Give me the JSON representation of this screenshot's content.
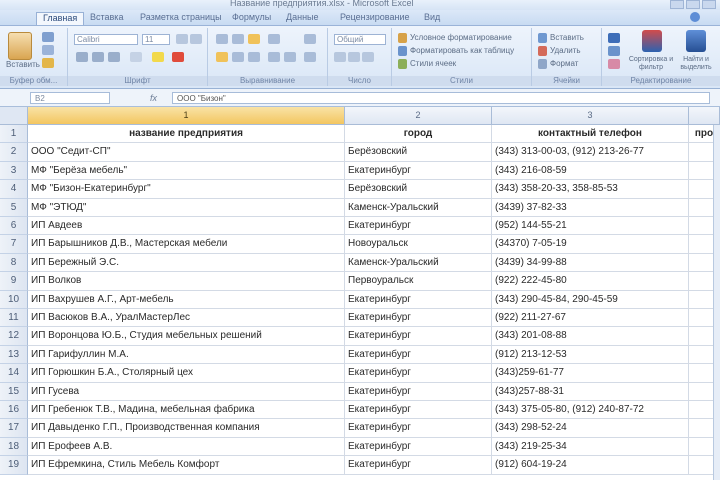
{
  "window": {
    "title": "Название предприятия.xlsx - Microsoft Excel"
  },
  "tabs": [
    {
      "label": "Главная",
      "active": true
    },
    {
      "label": "Вставка"
    },
    {
      "label": "Разметка страницы"
    },
    {
      "label": "Формулы"
    },
    {
      "label": "Данные"
    },
    {
      "label": "Рецензирование"
    },
    {
      "label": "Вид"
    }
  ],
  "ribbon": {
    "clipboard": {
      "label": "Буфер обм...",
      "paste": "Вставить"
    },
    "font": {
      "label": "Шрифт",
      "name": "Calibri",
      "size": "11"
    },
    "alignment": {
      "label": "Выравнивание"
    },
    "number": {
      "label": "Число",
      "format": "Общий"
    },
    "styles": {
      "label": "Стили",
      "conditional": "Условное форматирование",
      "table": "Форматировать как таблицу",
      "cell": "Стили ячеек"
    },
    "cells": {
      "label": "Ячейки",
      "insert": "Вставить",
      "delete": "Удалить",
      "format": "Формат"
    },
    "editing": {
      "label": "Редактирование",
      "sort": "Сортировка и фильтр",
      "find": "Найти и выделить"
    }
  },
  "formula_bar": {
    "name_box": "B2",
    "formula": "ООО \"Бизон\""
  },
  "columns": [
    {
      "letter": "1",
      "selected": true
    },
    {
      "letter": "2"
    },
    {
      "letter": "3"
    },
    {
      "letter": ""
    }
  ],
  "rows": [
    {
      "n": "1",
      "a": "название предприятия",
      "b": "город",
      "c": "контактный телефон",
      "d": "про",
      "header": true
    },
    {
      "n": "2",
      "a": "ООО \"Седит-СП\"",
      "b": "Берёзовский",
      "c": "(343) 313-00-03, (912) 213-26-77"
    },
    {
      "n": "3",
      "a": "МФ \"Берёза мебель\"",
      "b": "Екатеринбург",
      "c": "(343) 216-08-59"
    },
    {
      "n": "4",
      "a": "МФ \"Бизон-Екатеринбург\"",
      "b": "Берёзовский",
      "c": "(343) 358-20-33, 358-85-53"
    },
    {
      "n": "5",
      "a": "МФ \"ЭТЮД\"",
      "b": "Каменск-Уральский",
      "c": "(3439) 37-82-33"
    },
    {
      "n": "6",
      "a": "ИП Авдеев",
      "b": "Екатеринбург",
      "c": "(952) 144-55-21"
    },
    {
      "n": "7",
      "a": "ИП Барышников Д.В., Мастерская мебели",
      "b": "Новоуральск",
      "c": "(34370) 7-05-19"
    },
    {
      "n": "8",
      "a": "ИП Бережный Э.С.",
      "b": "Каменск-Уральский",
      "c": "(3439) 34-99-88"
    },
    {
      "n": "9",
      "a": "ИП Волков",
      "b": "Первоуральск",
      "c": "(922) 222-45-80"
    },
    {
      "n": "10",
      "a": "ИП Вахрушев А.Г., Арт-мебель",
      "b": "Екатеринбург",
      "c": "(343) 290-45-84, 290-45-59"
    },
    {
      "n": "11",
      "a": "ИП Васюков В.А., УралМастерЛес",
      "b": "Екатеринбург",
      "c": "(922) 211-27-67"
    },
    {
      "n": "12",
      "a": "ИП Воронцова Ю.Б., Студия мебельных решений",
      "b": "Екатеринбург",
      "c": "(343) 201-08-88"
    },
    {
      "n": "13",
      "a": "ИП Гарифуллин М.А.",
      "b": "Екатеринбург",
      "c": "(912) 213-12-53"
    },
    {
      "n": "14",
      "a": "ИП Горюшкин Б.А., Столярный цех",
      "b": "Екатеринбург",
      "c": "(343)259-61-77"
    },
    {
      "n": "15",
      "a": "ИП Гусева",
      "b": "Екатеринбург",
      "c": "(343)257-88-31"
    },
    {
      "n": "16",
      "a": "ИП Гребенюк Т.В., Мадина, мебельная фабрика",
      "b": "Екатеринбург",
      "c": "(343) 375-05-80, (912) 240-87-72"
    },
    {
      "n": "17",
      "a": "ИП Давыденко Г.П., Производственная компания",
      "b": "Екатеринбург",
      "c": "(343) 298-52-24"
    },
    {
      "n": "18",
      "a": "ИП Ерофеев А.В.",
      "b": "Екатеринбург",
      "c": "(343) 219-25-34"
    },
    {
      "n": "19",
      "a": "ИП Ефремкина, Стиль Мебель Комфорт",
      "b": "Екатеринбург",
      "c": "(912) 604-19-24"
    }
  ]
}
